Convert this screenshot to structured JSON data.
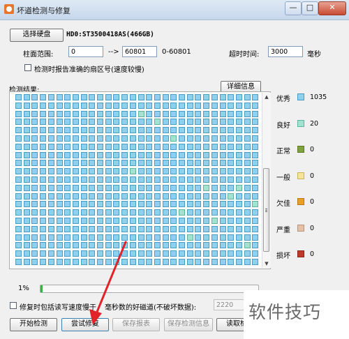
{
  "window": {
    "title": "坏道检测与修复",
    "min_label": "—",
    "max_label": "□",
    "close_label": "✕"
  },
  "disk": {
    "select_button": "选择硬盘",
    "name": "HD0:ST3500418AS(466GB)"
  },
  "range": {
    "label": "柱面范围:",
    "start": "0",
    "arrow": "-->",
    "end": "60801",
    "hint": "0-60801"
  },
  "timeout": {
    "label": "超时时间:",
    "value": "3000",
    "unit": "毫秒"
  },
  "option_report_lba": {
    "label": "检测时报告准确的扇区号(速度较慢)",
    "checked": false
  },
  "results": {
    "label": "检测结果:",
    "detail_button": "详细信息"
  },
  "legend": [
    {
      "label": "优秀",
      "color": "#8ed0ee",
      "border": "#4a9cc2",
      "count": "1035"
    },
    {
      "label": "良好",
      "color": "#a3e2d0",
      "border": "#5fb39a",
      "count": "20"
    },
    {
      "label": "正常",
      "color": "#7fa23b",
      "border": "#5a7a24",
      "count": "0"
    },
    {
      "label": "一般",
      "color": "#f7e39a",
      "border": "#c9b35f",
      "count": "0"
    },
    {
      "label": "欠佳",
      "color": "#e9a022",
      "border": "#b77a12",
      "count": "0"
    },
    {
      "label": "严重",
      "color": "#e3c0a6",
      "border": "#b8947a",
      "count": "0"
    },
    {
      "label": "损坏",
      "color": "#c0392b",
      "border": "#8e2419",
      "count": "0"
    }
  ],
  "progress": {
    "percent_label": "1%",
    "value": 0.01
  },
  "option_include_slow": {
    "label": "修复时包括读写速度慢于",
    "label_tail": "毫秒数的好磁道(不破坏数据):",
    "value": "2220",
    "checked": false
  },
  "buttons": {
    "start": "开始检测",
    "repair": "尝试修复",
    "save_report": "保存报表",
    "save_detail": "保存检测信息",
    "load": "读取检测"
  },
  "watermark": "软件技巧"
}
